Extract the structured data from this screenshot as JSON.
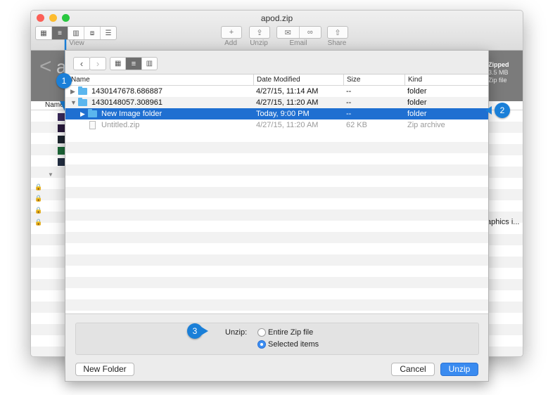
{
  "window": {
    "title": "apod.zip",
    "toolbar": {
      "view_label": "View",
      "add_label": "Add",
      "unzip_label": "Unzip",
      "email_label": "Email",
      "share_label": "Share"
    },
    "behind": {
      "back_glyph": "<",
      "back_letter": "a",
      "zipped_title": "Zipped",
      "zipped_size": "3.5 MB",
      "zipped_kind": "Zip file",
      "name_col": "Name",
      "graphics_text": "aphics i..."
    }
  },
  "sheet": {
    "columns": [
      "Name",
      "Date Modified",
      "Size",
      "Kind"
    ],
    "rows": [
      {
        "name": "1430147678.686887",
        "date": "4/27/15, 11:14 AM",
        "size": "--",
        "kind": "folder",
        "state": "normal",
        "expander": "▶"
      },
      {
        "name": "1430148057.308961",
        "date": "4/27/15, 11:20 AM",
        "size": "--",
        "kind": "folder",
        "state": "normal",
        "expander": "▼"
      },
      {
        "name": "New Image folder",
        "date": "Today, 9:00 PM",
        "size": "--",
        "kind": "folder",
        "state": "selected",
        "expander": "▶"
      },
      {
        "name": "Untitled.zip",
        "date": "4/27/15, 11:20 AM",
        "size": "62 KB",
        "kind": "Zip archive",
        "state": "dimmed",
        "expander": ""
      }
    ],
    "unzip_label": "Unzip:",
    "options": [
      {
        "label": "Entire Zip file",
        "selected": false
      },
      {
        "label": "Selected items",
        "selected": true
      }
    ],
    "buttons": {
      "new_folder": "New Folder",
      "cancel": "Cancel",
      "unzip": "Unzip"
    }
  },
  "callouts": [
    "1",
    "2",
    "3"
  ],
  "colors": {
    "accent": "#1f6fd1",
    "callout": "#1a7fd8",
    "folder": "#5bb6ee"
  }
}
